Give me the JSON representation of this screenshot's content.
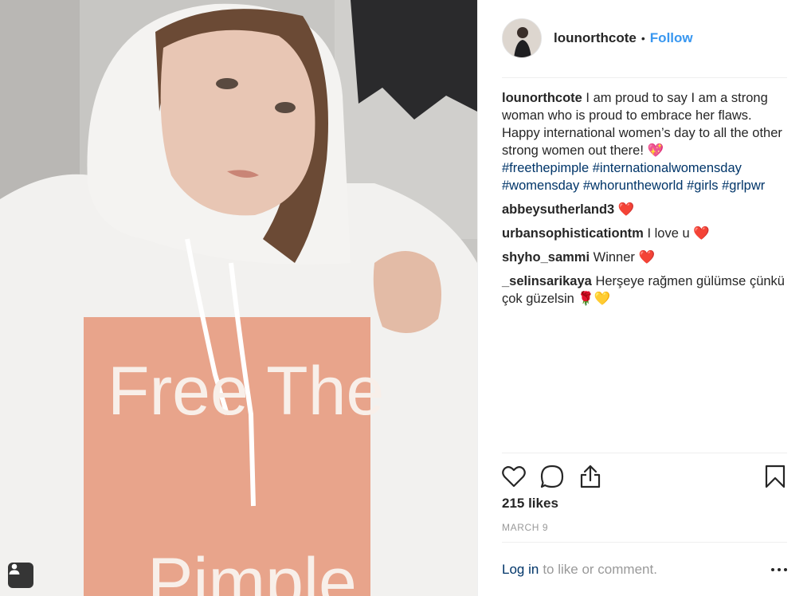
{
  "post": {
    "photo": {
      "hoodie_text_line1": "Free The",
      "hoodie_text_line2": "Pimple"
    },
    "header": {
      "username": "lounorthcote",
      "separator": "•",
      "follow_label": "Follow"
    },
    "caption": {
      "username": "lounorthcote",
      "text": "I am proud to say I am a strong woman who is proud to embrace her flaws. Happy international women’s day to all the other strong women out there! 💖",
      "hashtags": [
        "#freethepimple",
        "#internationalwomensday",
        "#womensday",
        "#whoruntheworld",
        "#girls",
        "#grlpwr"
      ]
    },
    "comments": [
      {
        "username": "abbeysutherland3",
        "text": "❤️"
      },
      {
        "username": "urbansophisticationtm",
        "text": "I love u ❤️"
      },
      {
        "username": "shyho_sammi",
        "text": "Winner ❤️"
      },
      {
        "username": "_selinsarikaya",
        "text": "Herşeye rağmen gülümse çünkü çok güzelsin 🌹💛"
      }
    ],
    "likes": "215 likes",
    "date": "MARCH 9",
    "footer": {
      "login_label": "Log in",
      "prompt": "to like or comment."
    },
    "icons": {
      "like": "heart-icon",
      "comment": "comment-bubble-icon",
      "share": "share-icon",
      "save": "bookmark-icon",
      "more": "more-options-icon",
      "tagged": "user-tag-icon"
    }
  }
}
